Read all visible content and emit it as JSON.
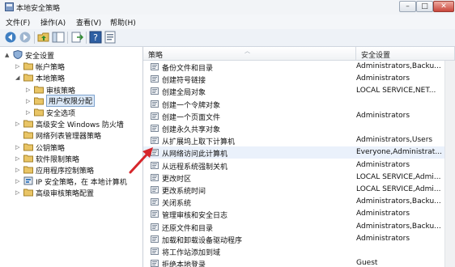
{
  "window": {
    "title": "本地安全策略"
  },
  "menu": [
    "文件(F)",
    "操作(A)",
    "查看(V)",
    "帮助(H)"
  ],
  "window_buttons": {
    "minimize": "–",
    "maximize": "□",
    "close": "✕"
  },
  "toolbar": [
    "back-icon",
    "forward-icon",
    "folder-up-icon",
    "show-tree-icon",
    "export-icon",
    "help-icon",
    "properties-icon"
  ],
  "tree": [
    {
      "label": "安全设置",
      "indent": 0,
      "toggle": "▲",
      "icon": "shield-icon"
    },
    {
      "label": "帐户策略",
      "indent": 1,
      "toggle": "▷",
      "icon": "folder-icon"
    },
    {
      "label": "本地策略",
      "indent": 1,
      "toggle": "◢",
      "icon": "folder-icon"
    },
    {
      "label": "审核策略",
      "indent": 2,
      "toggle": "▷",
      "icon": "folder-icon"
    },
    {
      "label": "用户权限分配",
      "indent": 2,
      "toggle": "▷",
      "icon": "folder-icon",
      "selected": true
    },
    {
      "label": "安全选项",
      "indent": 2,
      "toggle": "▷",
      "icon": "folder-icon"
    },
    {
      "label": "高级安全 Windows 防火墙",
      "indent": 1,
      "toggle": "▷",
      "icon": "folder-icon"
    },
    {
      "label": "网络列表管理器策略",
      "indent": 1,
      "toggle": "",
      "icon": "folder-icon"
    },
    {
      "label": "公钥策略",
      "indent": 1,
      "toggle": "▷",
      "icon": "folder-icon"
    },
    {
      "label": "软件限制策略",
      "indent": 1,
      "toggle": "▷",
      "icon": "folder-icon"
    },
    {
      "label": "应用程序控制策略",
      "indent": 1,
      "toggle": "▷",
      "icon": "folder-icon"
    },
    {
      "label": "IP 安全策略，在 本地计算机",
      "indent": 1,
      "toggle": "▷",
      "icon": "ipsec-icon"
    },
    {
      "label": "高级审核策略配置",
      "indent": 1,
      "toggle": "▷",
      "icon": "folder-icon"
    }
  ],
  "columns": {
    "policy": "策略",
    "setting": "安全设置"
  },
  "policies": [
    {
      "name": "备份文件和目录",
      "setting": "Administrators,Backu..."
    },
    {
      "name": "创建符号链接",
      "setting": "Administrators"
    },
    {
      "name": "创建全局对象",
      "setting": "LOCAL SERVICE,NET..."
    },
    {
      "name": "创建一个令牌对象",
      "setting": ""
    },
    {
      "name": "创建一个页面文件",
      "setting": "Administrators"
    },
    {
      "name": "创建永久共享对象",
      "setting": ""
    },
    {
      "name": "从扩展坞上取下计算机",
      "setting": "Administrators,Users"
    },
    {
      "name": "从网络访问此计算机",
      "setting": "Everyone,Administrat...",
      "highlight": true
    },
    {
      "name": "从远程系统强制关机",
      "setting": "Administrators"
    },
    {
      "name": "更改时区",
      "setting": "LOCAL SERVICE,Admi..."
    },
    {
      "name": "更改系统时间",
      "setting": "LOCAL SERVICE,Admi..."
    },
    {
      "name": "关闭系统",
      "setting": "Administrators,Backu..."
    },
    {
      "name": "管理审核和安全日志",
      "setting": "Administrators"
    },
    {
      "name": "还原文件和目录",
      "setting": "Administrators,Backu..."
    },
    {
      "name": "加载和卸载设备驱动程序",
      "setting": "Administrators"
    },
    {
      "name": "将工作站添加到域",
      "setting": ""
    },
    {
      "name": "拒绝本地登录",
      "setting": "Guest"
    }
  ],
  "colors": {
    "selection": "#dce9f8",
    "accent_arrow": "#d6262b"
  }
}
